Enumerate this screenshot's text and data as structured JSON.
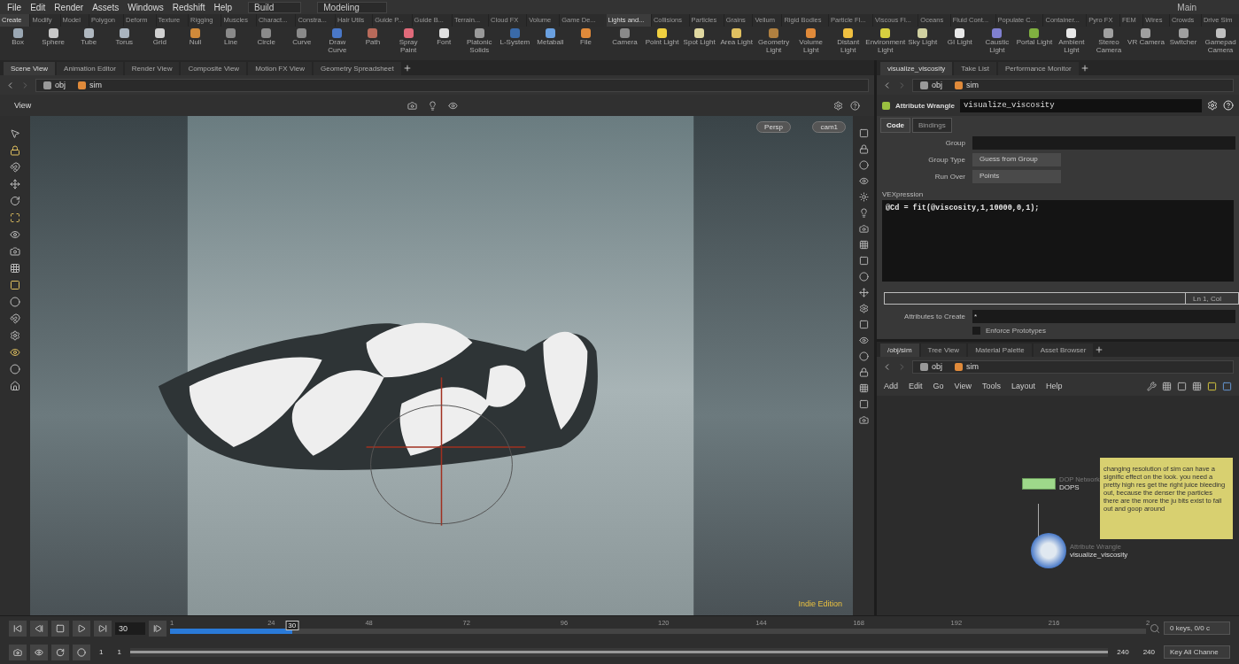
{
  "menu": [
    "File",
    "Edit",
    "Render",
    "Assets",
    "Windows",
    "Redshift",
    "Help"
  ],
  "desktop": "Build",
  "context": "Modeling",
  "main_label": "Main",
  "shelves": [
    {
      "tabs": [
        {
          "label": "Create",
          "selected": true
        },
        {
          "label": "Modify",
          "selected": false
        },
        {
          "label": "Model",
          "selected": false
        },
        {
          "label": "Polygon",
          "selected": false
        },
        {
          "label": "Deform",
          "selected": false
        },
        {
          "label": "Texture",
          "selected": false
        },
        {
          "label": "Rigging",
          "selected": false
        },
        {
          "label": "Muscles",
          "selected": false
        },
        {
          "label": "Charact...",
          "selected": false
        },
        {
          "label": "Constra...",
          "selected": false
        },
        {
          "label": "Hair Utils",
          "selected": false
        },
        {
          "label": "Guide P...",
          "selected": false
        },
        {
          "label": "Guide B...",
          "selected": false
        },
        {
          "label": "Terrain...",
          "selected": false
        },
        {
          "label": "Cloud FX",
          "selected": false
        },
        {
          "label": "Volume",
          "selected": false
        },
        {
          "label": "Game De...",
          "selected": false
        }
      ],
      "tools": [
        {
          "label": "Box",
          "color": "#9aa7b3"
        },
        {
          "label": "Sphere",
          "color": "#c8c8c8"
        },
        {
          "label": "Tube",
          "color": "#b0b8c0"
        },
        {
          "label": "Torus",
          "color": "#a9b4bf"
        },
        {
          "label": "Grid",
          "color": "#d0d0d0"
        },
        {
          "label": "Null",
          "color": "#d08a3a"
        },
        {
          "label": "Line",
          "color": "#8a8a8a"
        },
        {
          "label": "Circle",
          "color": "#8a8a8a"
        },
        {
          "label": "Curve",
          "color": "#8a8a8a"
        },
        {
          "label": "Draw Curve",
          "color": "#4a78c8"
        },
        {
          "label": "Path",
          "color": "#b86a5a"
        },
        {
          "label": "Spray Paint",
          "color": "#e06a7a"
        },
        {
          "label": "Font",
          "color": "#e0e0e0"
        },
        {
          "label": "Platonic Solids",
          "color": "#9a9a9a"
        },
        {
          "label": "L-System",
          "color": "#3a6aa8"
        },
        {
          "label": "Metaball",
          "color": "#6aa0e0"
        },
        {
          "label": "File",
          "color": "#e08a3a"
        }
      ]
    },
    {
      "tabs": [
        {
          "label": "Lights and...",
          "selected": true
        },
        {
          "label": "Collisions",
          "selected": false
        },
        {
          "label": "Particles",
          "selected": false
        },
        {
          "label": "Grains",
          "selected": false
        },
        {
          "label": "Vellum",
          "selected": false
        },
        {
          "label": "Rigid Bodies",
          "selected": false
        },
        {
          "label": "Particle Fl...",
          "selected": false
        },
        {
          "label": "Viscous Fl...",
          "selected": false
        },
        {
          "label": "Oceans",
          "selected": false
        },
        {
          "label": "Fluid Cont...",
          "selected": false
        },
        {
          "label": "Populate C...",
          "selected": false
        },
        {
          "label": "Container...",
          "selected": false
        },
        {
          "label": "Pyro FX",
          "selected": false
        },
        {
          "label": "FEM",
          "selected": false
        },
        {
          "label": "Wires",
          "selected": false
        },
        {
          "label": "Crowds",
          "selected": false
        },
        {
          "label": "Drive Sim",
          "selected": false
        }
      ],
      "tools": [
        {
          "label": "Camera",
          "color": "#8a8a8a"
        },
        {
          "label": "Point Light",
          "color": "#f0d040"
        },
        {
          "label": "Spot Light",
          "color": "#e0d8a0"
        },
        {
          "label": "Area Light",
          "color": "#e0c060"
        },
        {
          "label": "Geometry Light",
          "color": "#b08040"
        },
        {
          "label": "Volume Light",
          "color": "#e08a3a"
        },
        {
          "label": "Distant Light",
          "color": "#f0c040"
        },
        {
          "label": "Environment Light",
          "color": "#d8d040"
        },
        {
          "label": "Sky Light",
          "color": "#d0d0a0"
        },
        {
          "label": "GI Light",
          "color": "#e8e8e8"
        },
        {
          "label": "Caustic Light",
          "color": "#8080d0"
        },
        {
          "label": "Portal Light",
          "color": "#80b040"
        },
        {
          "label": "Ambient Light",
          "color": "#e8e8e8"
        },
        {
          "label": "Stereo Camera",
          "color": "#a0a0a0"
        },
        {
          "label": "VR Camera",
          "color": "#a0a0a0"
        },
        {
          "label": "Switcher",
          "color": "#a0a0a0"
        },
        {
          "label": "Gamepad Camera",
          "color": "#c0c0c0"
        }
      ]
    }
  ],
  "scene_pane": {
    "tabs": [
      {
        "label": "Scene View",
        "selected": true
      },
      {
        "label": "Animation Editor",
        "selected": false
      },
      {
        "label": "Render View",
        "selected": false
      },
      {
        "label": "Composite View",
        "selected": false
      },
      {
        "label": "Motion FX View",
        "selected": false
      },
      {
        "label": "Geometry Spreadsheet",
        "selected": false
      }
    ],
    "path": [
      "obj",
      "sim"
    ],
    "view_label": "View",
    "camera_menus": [
      "Persp",
      "cam1"
    ],
    "edition": "Indie Edition"
  },
  "parameter_pane": {
    "tabs": [
      {
        "label": "visualize_viscosity",
        "selected": true
      },
      {
        "label": "Take List",
        "selected": false
      },
      {
        "label": "Performance Monitor",
        "selected": false
      }
    ],
    "path": [
      "obj",
      "sim"
    ],
    "node_type": "Attribute Wrangle",
    "node_name": "visualize_viscosity",
    "subtabs": [
      {
        "label": "Code",
        "selected": true
      },
      {
        "label": "Bindings",
        "selected": false
      }
    ],
    "params": [
      {
        "label": "Group",
        "kind": "text"
      },
      {
        "label": "Group Type",
        "kind": "menu",
        "value": "Guess from Group"
      },
      {
        "label": "Run Over",
        "kind": "menu",
        "value": "Points"
      }
    ],
    "code_label": "VEXpression",
    "code": "@Cd = fit(@viscosity,1,10000,0,1);",
    "cursor_status": "Ln 1, Col",
    "attributes_label": "Attributes to Create",
    "attributes_value": "*",
    "enforce": {
      "label": "Enforce Prototypes",
      "checked": false
    }
  },
  "network_pane": {
    "tabs": [
      {
        "label": "/obj/sim",
        "selected": true
      },
      {
        "label": "Tree View",
        "selected": false
      },
      {
        "label": "Material Palette",
        "selected": false
      },
      {
        "label": "Asset Browser",
        "selected": false
      }
    ],
    "path": [
      "obj",
      "sim"
    ],
    "menu": [
      "Add",
      "Edit",
      "Go",
      "View",
      "Tools",
      "Layout",
      "Help"
    ],
    "nodes": [
      {
        "kind": "dop",
        "type": "DOP Network",
        "name": "DOPS"
      },
      {
        "kind": "wrangle",
        "type": "Attribute Wrangle",
        "name": "visualize_viscosity"
      }
    ],
    "note": "changing resolution of sim can have a signific effect on the look. you need a pretty high res get the right juice bleeding out, because the denser the particles there are the more the ju bits exist to fall out and goop around"
  },
  "timeline": {
    "frame": "30",
    "ticks": [
      "1",
      "24",
      "48",
      "72",
      "96",
      "120",
      "144",
      "168",
      "192",
      "216",
      "2"
    ],
    "level": 0.125,
    "marker": "30",
    "keys_status": "0 keys, 0/0 c",
    "start": "1",
    "range_start": "1",
    "range": {
      "level": 1
    },
    "range_end": "240",
    "end": "240",
    "key_button": "Key All Channe"
  }
}
